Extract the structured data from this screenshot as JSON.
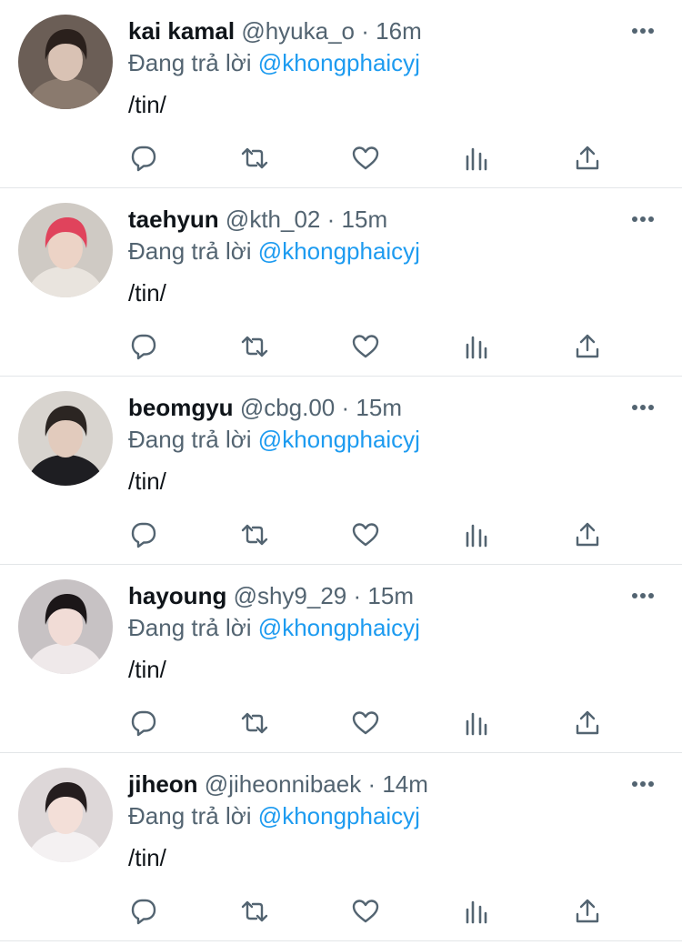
{
  "tweets": [
    {
      "name": "kai kamal",
      "handle": "@hyuka_o",
      "separator": "·",
      "time": "16m",
      "reply_prefix": "Đang trả lời",
      "reply_to": "@khongphaicyj",
      "text": "/tin/",
      "avatar_colors": {
        "bg": "#6b5e56",
        "hair": "#2a201c",
        "face": "#d9c2b4",
        "cloth": "#8a7a6e"
      }
    },
    {
      "name": "taehyun",
      "handle": "@kth_02",
      "separator": "·",
      "time": "15m",
      "reply_prefix": "Đang trả lời",
      "reply_to": "@khongphaicyj",
      "text": "/tin/",
      "avatar_colors": {
        "bg": "#cfcac4",
        "hair": "#e0435c",
        "face": "#ecd3c6",
        "cloth": "#e9e4de"
      }
    },
    {
      "name": "beomgyu",
      "handle": "@cbg.00",
      "separator": "·",
      "time": "15m",
      "reply_prefix": "Đang trả lời",
      "reply_to": "@khongphaicyj",
      "text": "/tin/",
      "avatar_colors": {
        "bg": "#d8d4cf",
        "hair": "#2b2522",
        "face": "#e2cbbd",
        "cloth": "#1e1e22"
      }
    },
    {
      "name": "hayoung",
      "handle": "@shy9_29",
      "separator": "·",
      "time": "15m",
      "reply_prefix": "Đang trả lời",
      "reply_to": "@khongphaicyj",
      "text": "/tin/",
      "avatar_colors": {
        "bg": "#c7c2c4",
        "hair": "#1b1618",
        "face": "#f1dcd6",
        "cloth": "#efe9ea"
      }
    },
    {
      "name": "jiheon",
      "handle": "@jiheonnibaek",
      "separator": "·",
      "time": "14m",
      "reply_prefix": "Đang trả lời",
      "reply_to": "@khongphaicyj",
      "text": "/tin/",
      "avatar_colors": {
        "bg": "#ddd7d8",
        "hair": "#241d1e",
        "face": "#f3dfd8",
        "cloth": "#f4f1f2"
      }
    }
  ],
  "icons": {
    "reply": "reply-bubble-icon",
    "retweet": "retweet-icon",
    "like": "heart-icon",
    "stats": "analytics-bars-icon",
    "share": "share-upload-icon",
    "more": "more-dots-icon"
  },
  "colors": {
    "text": "#0f1419",
    "secondary": "#536471",
    "link": "#1d9bf0",
    "divider": "#e3e6e8"
  }
}
